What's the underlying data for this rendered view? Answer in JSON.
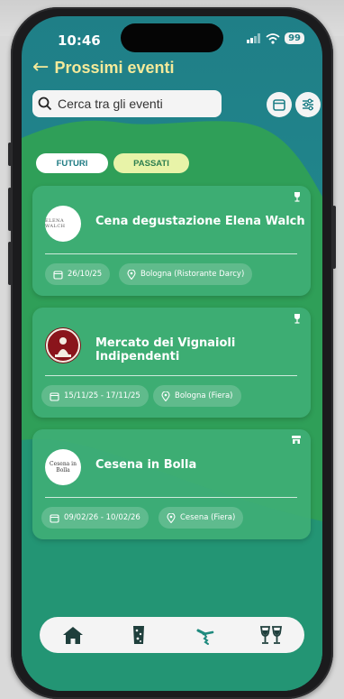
{
  "status_bar": {
    "time": "10:46",
    "battery": "99"
  },
  "header": {
    "title": "Prossimi eventi"
  },
  "search": {
    "placeholder": "Cerca tra gli eventi",
    "value": ""
  },
  "tabs": [
    {
      "label": "FUTURI",
      "active": false
    },
    {
      "label": "PASSATI",
      "active": true
    }
  ],
  "events": [
    {
      "logo_text": "ELENA WALCH",
      "title": "Cena degustazione Elena Walch",
      "type_icon": "wine-glass-icon",
      "date": "26/10/25",
      "location": "Bologna (Ristorante Darcy)"
    },
    {
      "logo_text": "",
      "title": "Mercato dei Vignaioli Indipendenti",
      "type_icon": "wine-glass-icon",
      "date": "15/11/25 - 17/11/25",
      "location": "Bologna (Fiera)"
    },
    {
      "logo_text": "Cesena in Bolla",
      "title": "Cesena in Bolla",
      "type_icon": "store-icon",
      "date": "09/02/26 - 10/02/26",
      "location": "Cesena (Fiera)"
    }
  ],
  "bottom_nav": [
    {
      "icon": "home-icon",
      "active": false
    },
    {
      "icon": "cork-icon",
      "active": false
    },
    {
      "icon": "corkscrew-icon",
      "active": true
    },
    {
      "icon": "wine-glasses-icon",
      "active": false
    }
  ],
  "colors": {
    "accent_yellow": "#f5ea9a",
    "card_green": "#40af76",
    "active_nav": "#1f8a7e",
    "background_teal": "#1f7f87"
  }
}
